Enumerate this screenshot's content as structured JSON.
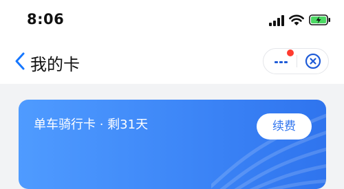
{
  "status_bar": {
    "time": "8:06",
    "icons": [
      "cellular-signal-icon",
      "wifi-icon",
      "battery-charging-icon"
    ],
    "battery_color": "#4cd964"
  },
  "nav": {
    "title": "我的卡",
    "back_icon": "chevron-left-icon",
    "more_icon": "more-dots-icon",
    "close_icon": "close-circle-icon",
    "accent_color": "#1677ff",
    "notification_dot_color": "#ff3b30"
  },
  "card": {
    "title": "单车骑行卡 · 剩31天",
    "renew_label": "续费",
    "gradient": [
      "#4f9bff",
      "#2f74ee"
    ],
    "text_color": "#ffffff",
    "button_text_color": "#2f74ee"
  }
}
